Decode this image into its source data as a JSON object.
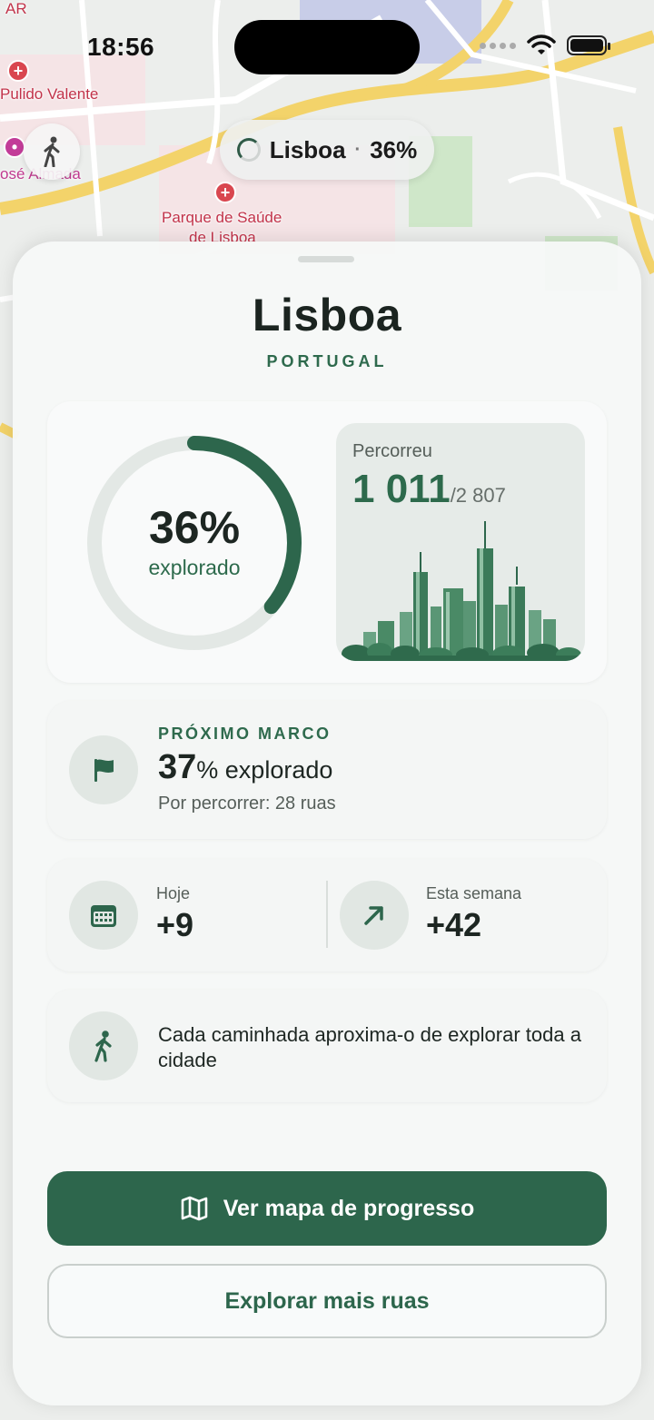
{
  "status_bar": {
    "time": "18:56"
  },
  "map": {
    "labels": {
      "hospital": "Pulido Valente",
      "hospital_cropped": "osé Almada",
      "park": "Parque de Saúde",
      "park_line2": "de Lisboa",
      "top_left": "AR"
    },
    "floating": {
      "walk_icon": "walking-person-icon",
      "city_pill_name": "Lisboa",
      "city_pill_separator": "·",
      "city_pill_pct": "36%"
    }
  },
  "sheet": {
    "title": "Lisboa",
    "subtitle": "PORTUGAL",
    "progress": {
      "percent_text": "36%",
      "percent_value": 36,
      "caption": "explorado",
      "walked_label": "Percorreu",
      "walked_count": "1 011",
      "walked_total": "/2 807"
    },
    "milestone": {
      "icon": "flag-icon",
      "label": "PRÓXIMO MARCO",
      "pct": "37",
      "rest": "% explorado",
      "sub": "Por percorrer: 28 ruas"
    },
    "stats": {
      "today_icon": "calendar-icon",
      "today_label": "Hoje",
      "today_value": "+9",
      "week_icon": "arrow-up-right-icon",
      "week_label": "Esta semana",
      "week_value": "+42"
    },
    "tip": {
      "icon": "walking-person-icon",
      "text": "Cada caminhada aproxima-o de explorar toda a cidade"
    },
    "buttons": {
      "primary_icon": "map-icon",
      "primary_label": "Ver mapa de progresso",
      "secondary_label": "Explorar mais ruas"
    }
  },
  "colors": {
    "accent": "#2d664c",
    "ring_track": "#e3e8e5",
    "sheet_bg": "#f6f8f7"
  }
}
